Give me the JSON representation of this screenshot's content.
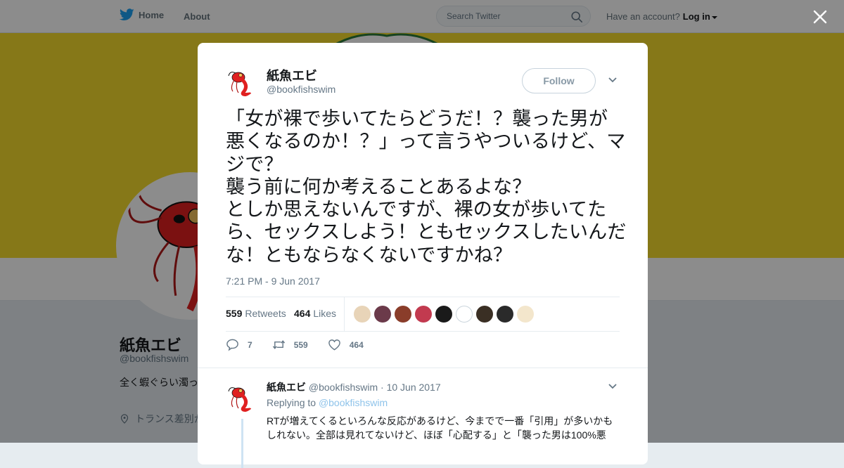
{
  "topbar": {
    "home_label": "Home",
    "about_label": "About",
    "search_placeholder": "Search Twitter",
    "account_prompt": "Have an account?",
    "login_label": "Log in"
  },
  "profile": {
    "name": "紙魚エビ",
    "handle": "@bookfishswim",
    "bio": "全く蝦ぐらい濁っ 物はいないのであ",
    "location": "トランス差別か しないでくださ",
    "banner_color": "#f4db2c"
  },
  "tweet": {
    "author_name": "紙魚エビ",
    "author_handle": "@bookfishswim",
    "follow_label": "Follow",
    "text": "「女が裸で歩いてたらどうだ！？襲った男が悪くなるのか！？」って言うやついるけど、マジで？\n襲う前に何か考えることあるよな？\nとしか思えないんですが、裸の女が歩いてたら、セックスしよう！ともセックスしたいんだな！ともならなくないですかね？",
    "timestamp": "7:21 PM - 9 Jun 2017",
    "retweet_count": "559",
    "retweets_label": "Retweets",
    "like_count": "464",
    "likes_label": "Likes",
    "actions": {
      "reply": "7",
      "retweet": "559",
      "like": "464"
    },
    "liker_colors": [
      "#e8d4b8",
      "#6b3a4a",
      "#8a3d2a",
      "#c23a4f",
      "#1a1a1a",
      "#ffffff",
      "#3a2f24",
      "#2a2a2a",
      "#f3e6cc"
    ]
  },
  "reply": {
    "author_name": "紙魚エビ",
    "author_handle": "@bookfishswim",
    "separator": "·",
    "date": "10 Jun 2017",
    "replying_label": "Replying to",
    "replying_to": "@bookfishswim",
    "text": "RTが増えてくるといろんな反応があるけど、今までで一番「引用」が多いかもしれない。全部は見れてないけど、ほぼ「心配する」と「襲った男は100%悪"
  },
  "colors": {
    "accent": "#1da1f2",
    "shrimp": "#e02020",
    "text": "#14171a",
    "muted": "#657786"
  },
  "icons": [
    "twitter-bird-icon",
    "search-icon",
    "close-icon",
    "chevron-down-icon",
    "reply-icon",
    "retweet-icon",
    "heart-icon",
    "location-pin-icon"
  ]
}
